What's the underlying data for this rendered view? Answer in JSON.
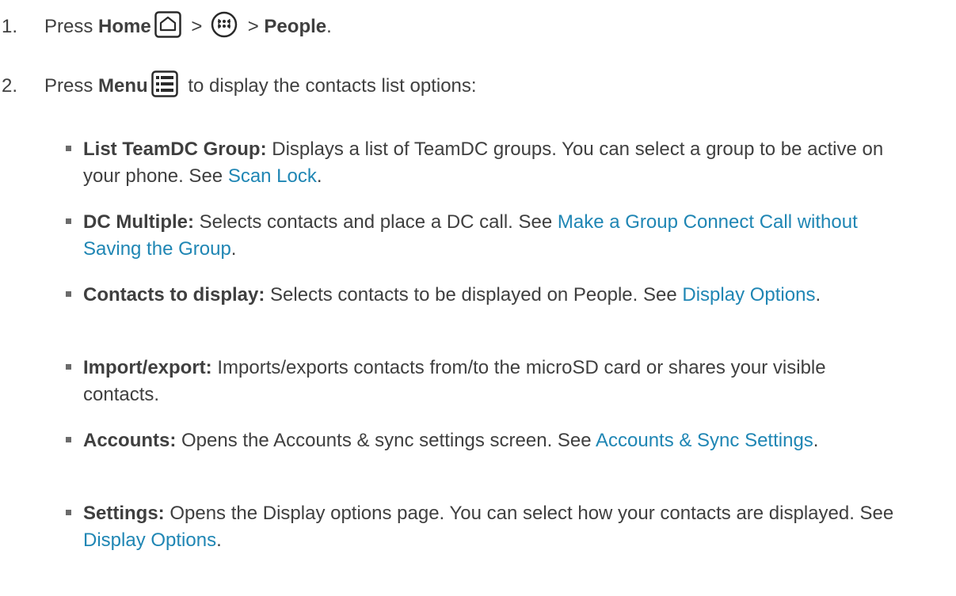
{
  "steps": [
    {
      "num": "1.",
      "pre": "Press ",
      "home_bold": "Home",
      "sep1": " > ",
      "sep2": " > ",
      "people_bold": "People",
      "end": ".",
      "icons": [
        "home-icon",
        "apps-icon"
      ]
    },
    {
      "num": "2.",
      "pre": "Press ",
      "menu_bold": "Menu",
      "post": " to display the contacts list options:",
      "icons": [
        "menu-icon"
      ]
    }
  ],
  "bullets": [
    {
      "term": "List TeamDC Group:",
      "text": " Displays a list of TeamDC groups. You can select a group to be active on your phone. See ",
      "link": "Scan Lock",
      "end": "."
    },
    {
      "term": "DC Multiple:",
      "text": " Selects contacts and place a DC call. See ",
      "link": "Make a Group Connect Call without Saving the Group",
      "end": "."
    },
    {
      "term": "Contacts to display:",
      "text": " Selects contacts to be displayed on People. See ",
      "link": "Display Options",
      "end": "."
    },
    {
      "term": "Import/export:",
      "text": " Imports/exports contacts from/to the microSD card or shares your visible contacts.",
      "link": "",
      "end": ""
    },
    {
      "term": "Accounts:",
      "text": " Opens the Accounts & sync settings screen. See ",
      "link": "Accounts & Sync Settings",
      "end": "."
    },
    {
      "term": "Settings:",
      "text": " Opens the Display options page. You can select how your contacts are displayed. See ",
      "link": "Display Options",
      "end": "."
    }
  ],
  "colors": {
    "text": "#3f3f3f",
    "link": "#1f86b4"
  }
}
